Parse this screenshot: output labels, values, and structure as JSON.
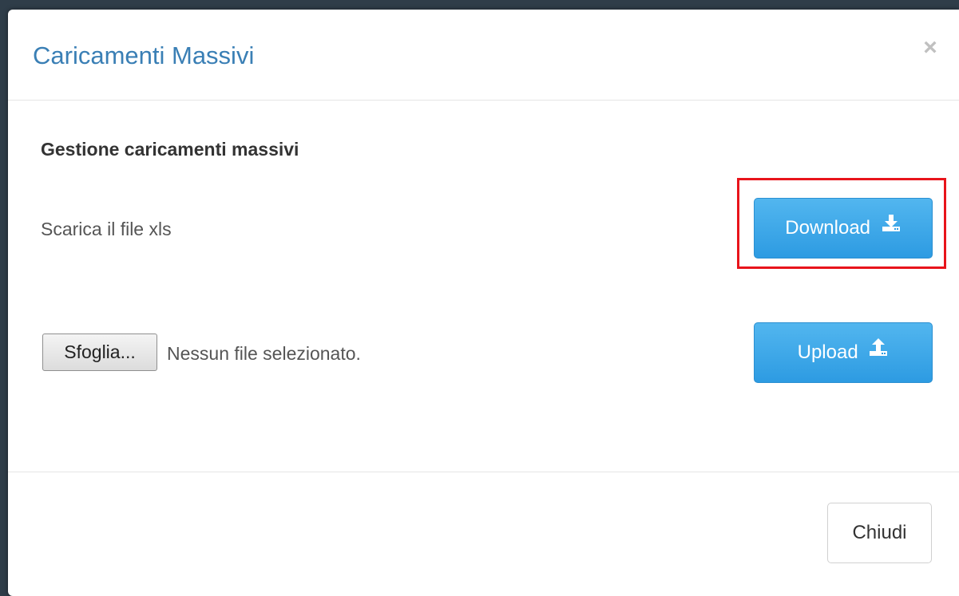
{
  "modal": {
    "title": "Caricamenti Massivi",
    "close_glyph": "×"
  },
  "body": {
    "section_title": "Gestione caricamenti massivi",
    "download_label": "Scarica il file xls",
    "download_button": {
      "label": "Download",
      "icon": "download-icon"
    },
    "browse_button": "Sfoglia...",
    "no_file_text": "Nessun file selezionato.",
    "upload_button": {
      "label": "Upload",
      "icon": "upload-icon"
    }
  },
  "footer": {
    "close_label": "Chiudi"
  },
  "colors": {
    "title": "#3a7fb5",
    "primary_button": "#2d9be2",
    "highlight": "#e8141b",
    "backdrop": "#2f3d49"
  }
}
